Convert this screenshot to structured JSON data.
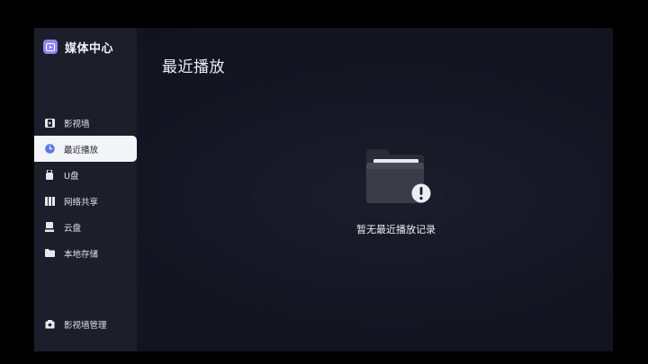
{
  "app": {
    "title": "媒体中心"
  },
  "sidebar": {
    "items": [
      {
        "label": "影视墙",
        "icon": "film-icon"
      },
      {
        "label": "最近播放",
        "icon": "clock-icon",
        "active": true
      },
      {
        "label": "U盘",
        "icon": "usb-drive-icon"
      },
      {
        "label": "网络共享",
        "icon": "network-share-icon"
      },
      {
        "label": "云盘",
        "icon": "cloud-drive-icon"
      },
      {
        "label": "本地存储",
        "icon": "folder-icon"
      }
    ],
    "bottom": {
      "label": "影视墙管理",
      "icon": "wall-manage-icon"
    }
  },
  "main": {
    "title": "最近播放",
    "empty_message": "暂无最近播放记录"
  },
  "colors": {
    "accent": "#8f86f2",
    "active_item_bg": "#f3f4f8",
    "active_icon": "#5a78e8",
    "sidebar_bg": "#1c1e2a",
    "content_bg": "#141623"
  }
}
